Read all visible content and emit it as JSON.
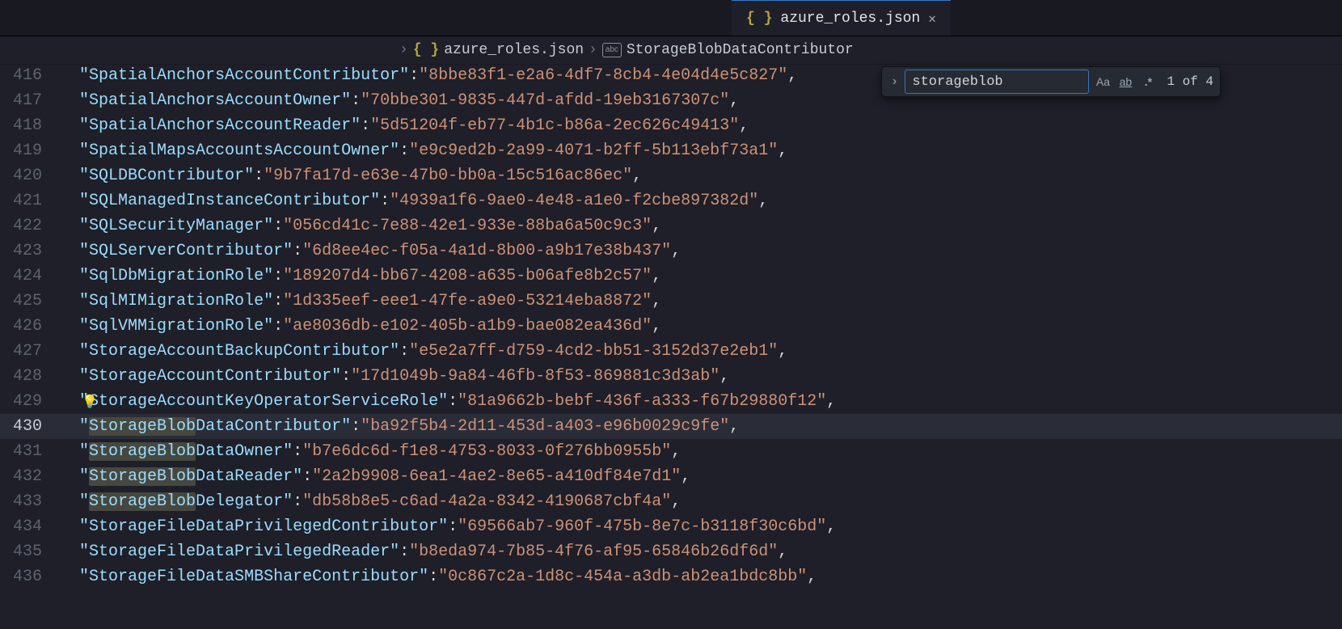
{
  "tab": {
    "filename": "azure_roles.json"
  },
  "breadcrumb": {
    "file": "azure_roles.json",
    "symbol": "StorageBlobDataContributor"
  },
  "search": {
    "value": "storageblob",
    "count": "1 of 4"
  },
  "lines": [
    {
      "n": 416,
      "key": "SpatialAnchorsAccountContributor",
      "val": "8bbe83f1-e2a6-4df7-8cb4-4e04d4e5c827"
    },
    {
      "n": 417,
      "key": "SpatialAnchorsAccountOwner",
      "val": "70bbe301-9835-447d-afdd-19eb3167307c"
    },
    {
      "n": 418,
      "key": "SpatialAnchorsAccountReader",
      "val": "5d51204f-eb77-4b1c-b86a-2ec626c49413"
    },
    {
      "n": 419,
      "key": "SpatialMapsAccountsAccountOwner",
      "val": "e9c9ed2b-2a99-4071-b2ff-5b113ebf73a1"
    },
    {
      "n": 420,
      "key": "SQLDBContributor",
      "val": "9b7fa17d-e63e-47b0-bb0a-15c516ac86ec"
    },
    {
      "n": 421,
      "key": "SQLManagedInstanceContributor",
      "val": "4939a1f6-9ae0-4e48-a1e0-f2cbe897382d"
    },
    {
      "n": 422,
      "key": "SQLSecurityManager",
      "val": "056cd41c-7e88-42e1-933e-88ba6a50c9c3"
    },
    {
      "n": 423,
      "key": "SQLServerContributor",
      "val": "6d8ee4ec-f05a-4a1d-8b00-a9b17e38b437"
    },
    {
      "n": 424,
      "key": "SqlDbMigrationRole",
      "val": "189207d4-bb67-4208-a635-b06afe8b2c57"
    },
    {
      "n": 425,
      "key": "SqlMIMigrationRole",
      "val": "1d335eef-eee1-47fe-a9e0-53214eba8872"
    },
    {
      "n": 426,
      "key": "SqlVMMigrationRole",
      "val": "ae8036db-e102-405b-a1b9-bae082ea436d"
    },
    {
      "n": 427,
      "key": "StorageAccountBackupContributor",
      "val": "e5e2a7ff-d759-4cd2-bb51-3152d37e2eb1"
    },
    {
      "n": 428,
      "key": "StorageAccountContributor",
      "val": "17d1049b-9a84-46fb-8f53-869881c3d3ab"
    },
    {
      "n": 429,
      "key": "StorageAccountKeyOperatorServiceRole",
      "val": "81a9662b-bebf-436f-a333-f67b29880f12",
      "bulb": true
    },
    {
      "n": 430,
      "key": "StorageBlobDataContributor",
      "val": "ba92f5b4-2d11-453d-a403-e96b0029c9fe",
      "current": true,
      "matchPrefix": "StorageBlob"
    },
    {
      "n": 431,
      "key": "StorageBlobDataOwner",
      "val": "b7e6dc6d-f1e8-4753-8033-0f276bb0955b",
      "matchPrefix": "StorageBlob"
    },
    {
      "n": 432,
      "key": "StorageBlobDataReader",
      "val": "2a2b9908-6ea1-4ae2-8e65-a410df84e7d1",
      "matchPrefix": "StorageBlob"
    },
    {
      "n": 433,
      "key": "StorageBlobDelegator",
      "val": "db58b8e5-c6ad-4a2a-8342-4190687cbf4a",
      "matchPrefix": "StorageBlob"
    },
    {
      "n": 434,
      "key": "StorageFileDataPrivilegedContributor",
      "val": "69566ab7-960f-475b-8e7c-b3118f30c6bd"
    },
    {
      "n": 435,
      "key": "StorageFileDataPrivilegedReader",
      "val": "b8eda974-7b85-4f76-af95-65846b26df6d"
    },
    {
      "n": 436,
      "key": "StorageFileDataSMBShareContributor",
      "val": "0c867c2a-1d8c-454a-a3db-ab2ea1bdc8bb"
    }
  ]
}
